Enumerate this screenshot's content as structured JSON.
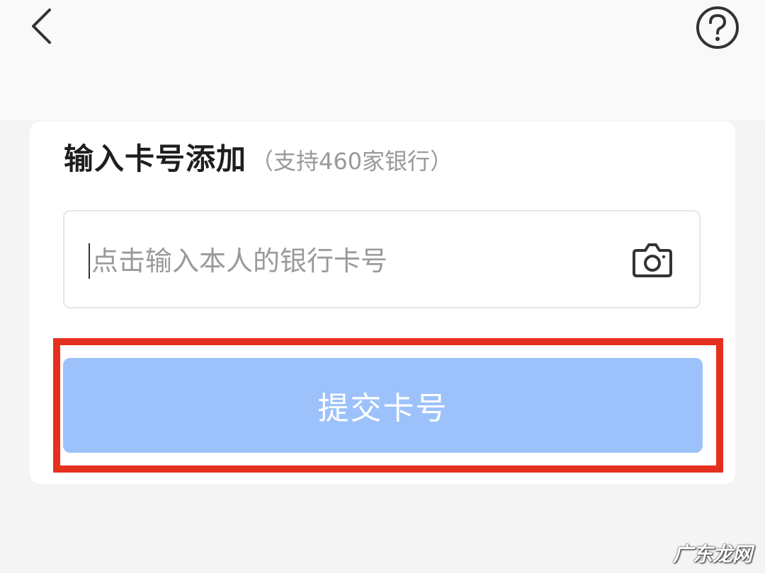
{
  "nav": {
    "back_icon": "chevron-left-icon",
    "help_icon": "question-circle-icon"
  },
  "form": {
    "title": "输入卡号添加",
    "subtitle": "（支持460家银行）",
    "card_input": {
      "value": "",
      "placeholder": "点击输入本人的银行卡号",
      "scan_icon": "camera-icon"
    },
    "submit_label": "提交卡号"
  },
  "highlight": {
    "color": "#e5301f"
  },
  "watermark": "广东龙网",
  "colors": {
    "submit_bg": "#9dc2fb",
    "submit_text": "#ffffff",
    "page_bg": "#f4f4f5"
  }
}
